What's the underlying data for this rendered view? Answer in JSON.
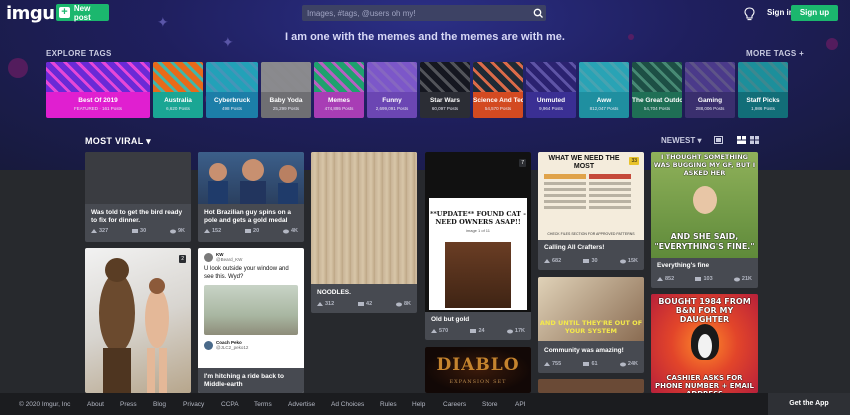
{
  "header": {
    "logo": "imgur",
    "new_post": "New post",
    "search_placeholder": "Images, #tags, @users oh my!",
    "sign_in": "Sign in",
    "sign_up": "Sign up"
  },
  "tagline": "I am one with the memes and the memes are with me.",
  "explore": {
    "title": "EXPLORE TAGS",
    "more": "MORE TAGS +"
  },
  "tags": [
    {
      "name": "Best Of 2019",
      "posts": "FEATURED · 161 Posts",
      "color": "#e01fd0",
      "img": "#6a2ad6"
    },
    {
      "name": "Australia",
      "posts": "6,620 Posts",
      "color": "#1aa694",
      "img": "#e86a1a"
    },
    {
      "name": "Cyberbruck",
      "posts": "498 Posts",
      "color": "#1c7ea8",
      "img": "#23a1b8"
    },
    {
      "name": "Baby Yoda",
      "posts": "25,299 Posts",
      "color": "#6f6f73",
      "img": "#8a8a8e"
    },
    {
      "name": "Memes",
      "posts": "474,895 Posts",
      "color": "#a83db5",
      "img": "#1ea16e"
    },
    {
      "name": "Funny",
      "posts": "2,699,091 Posts",
      "color": "#6b46b3",
      "img": "#7c57c9"
    },
    {
      "name": "Star Wars",
      "posts": "60,097 Posts",
      "color": "#2b2d35",
      "img": "#151720"
    },
    {
      "name": "Science And Tech",
      "posts": "54,570 Posts",
      "color": "#d34a21",
      "img": "#1f2a35"
    },
    {
      "name": "Unmuted",
      "posts": "9,964 Posts",
      "color": "#3a2f93",
      "img": "#2b2270"
    },
    {
      "name": "Aww",
      "posts": "812,047 Posts",
      "color": "#1f8fa0",
      "img": "#29a3b5"
    },
    {
      "name": "The Great Outdoors",
      "posts": "54,704 Posts",
      "color": "#1f6f55",
      "img": "#1d4f45"
    },
    {
      "name": "Gaming",
      "posts": "288,006 Posts",
      "color": "#3a2f6e",
      "img": "#4b3a8a"
    },
    {
      "name": "Staff Picks",
      "posts": "1,986 Posts",
      "color": "#126e78",
      "img": "#1c8f9b"
    }
  ],
  "feed": {
    "section": "MOST VIRAL",
    "sort": "NEWEST",
    "cards": [
      {
        "title": "Was told to get the bird ready to fix for dinner.",
        "up": "327",
        "comments": "30",
        "views": "9K"
      },
      {
        "title": "Hot Brazilian guy spins on a pole and gets a gold medal",
        "up": "152",
        "comments": "20",
        "views": "4K"
      },
      {
        "title": "NOODLES.",
        "up": "312",
        "comments": "42",
        "views": "8K"
      },
      {
        "title": "Old but gold",
        "up": "570",
        "comments": "24",
        "views": "17K",
        "badge": "7",
        "inner_title": "**UPDATE** FOUND CAT - NEED OWNERS ASAP!!",
        "inner_sub": "image 1 of 11"
      },
      {
        "title": "Calling All Crafters!",
        "up": "682",
        "comments": "30",
        "views": "15K",
        "badge": "33",
        "inner_title": "WHAT WE NEED THE MOST",
        "inner_sub": "CHECK FILES SECTION FOR APPROVED PATTERNS"
      },
      {
        "title": "Everything's fine",
        "up": "852",
        "comments": "103",
        "views": "21K",
        "top_text": "I THOUGHT SOMETHING WAS BUGGING MY GF, BUT I ASKED HER",
        "bottom_text": "AND SHE SAID, \"EVERYTHING'S FINE.\""
      },
      {
        "title": "",
        "up": "",
        "comments": "",
        "views": "",
        "badge": "2"
      },
      {
        "title": "I'm hitching a ride back to Middle-earth",
        "user": "KW",
        "handle": "@Beard_KW",
        "tweet": "U look outside your window and see this. Wyd?",
        "reply_user": "Coach Peko",
        "reply_handle": "@JLC2_peko12"
      },
      {
        "title": "Community was amazing!",
        "up": "755",
        "comments": "61",
        "views": "24K",
        "meme_text": "AND UNTIL THEY'RE OUT OF YOUR SYSTEM"
      },
      {
        "title": "",
        "game": "DIABLO",
        "game_sub": "EXPANSION SET"
      },
      {
        "title": "",
        "top_text": "BOUGHT 1984 FROM B&N FOR MY DAUGHTER",
        "bottom_text": "CASHIER ASKS FOR PHONE NUMBER + EMAIL ADDRESS"
      }
    ]
  },
  "footer": {
    "items": [
      "© 2020 Imgur, Inc",
      "About",
      "Press",
      "Blog",
      "Privacy",
      "CCPA",
      "Terms",
      "Advertise",
      "Ad Choices",
      "Rules",
      "Help",
      "Careers",
      "Store",
      "API"
    ],
    "get_app": "Get the App"
  }
}
